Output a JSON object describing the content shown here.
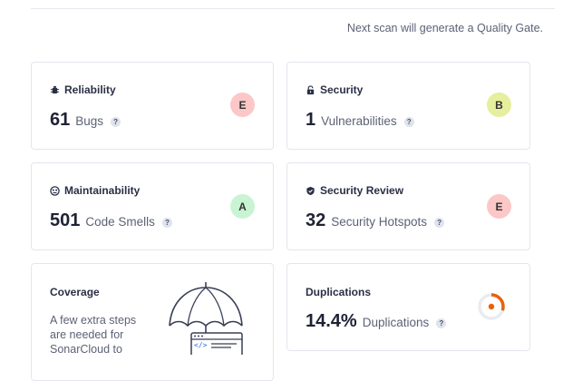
{
  "scan_note": "Next scan will generate a Quality Gate.",
  "cards": {
    "reliability": {
      "title": "Reliability",
      "value": "61",
      "label": "Bugs",
      "rating": "E",
      "rating_color": "#fcc7c7",
      "icon": "bug-icon"
    },
    "security": {
      "title": "Security",
      "value": "1",
      "label": "Vulnerabilities",
      "rating": "B",
      "rating_color": "#e5ef9d",
      "icon": "lock-icon"
    },
    "maintainability": {
      "title": "Maintainability",
      "value": "501",
      "label": "Code Smells",
      "rating": "A",
      "rating_color": "#c9f4d3",
      "icon": "maintainability-icon"
    },
    "security_review": {
      "title": "Security Review",
      "value": "32",
      "label": "Security Hotspots",
      "rating": "E",
      "rating_color": "#fcc7c7",
      "icon": "shield-icon"
    },
    "coverage": {
      "title": "Coverage",
      "text": "A few extra steps are needed for SonarCloud to",
      "icon": "umbrella-icon"
    },
    "duplications": {
      "title": "Duplications",
      "value": "14.4%",
      "label": "Duplications",
      "icon": "duplication-donut-icon",
      "donut_fraction": 0.3
    }
  },
  "help_glyph": "?",
  "colors": {
    "accent_orange": "#e8620b",
    "border": "#e3e6ed"
  }
}
